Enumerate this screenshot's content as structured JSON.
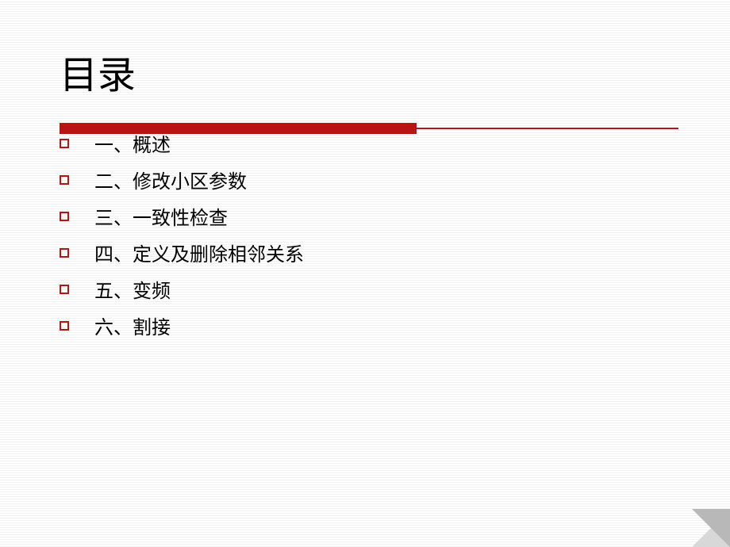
{
  "title": "目录",
  "items": [
    {
      "label": "一、概述"
    },
    {
      "label": "二、修改小区参数"
    },
    {
      "label": "三、一致性检查"
    },
    {
      "label": "四、定义及删除相邻关系"
    },
    {
      "label": "五、变频"
    },
    {
      "label": "六、割接"
    }
  ],
  "colors": {
    "accent": "#b81414"
  }
}
